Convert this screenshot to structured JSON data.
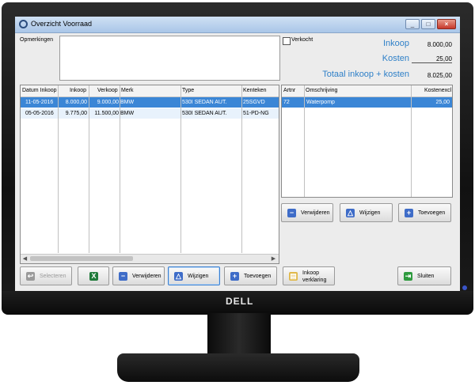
{
  "window": {
    "title": "Overzicht Voorraad",
    "min": "_",
    "max": "□",
    "close": "×"
  },
  "form": {
    "opmerkingen_label": "Opmerkingen",
    "verkocht_label": "Verkocht"
  },
  "summary": {
    "inkoop_label": "Inkoop",
    "inkoop_value": "8.000,00",
    "kosten_label": "Kosten",
    "kosten_value": "25,00",
    "totaal_label": "Totaal inkoop + kosten",
    "totaal_value": "8.025,00"
  },
  "stock_table": {
    "headers": [
      "Datum Inkoop",
      "Inkoop",
      "Verkoop",
      "Merk",
      "Type",
      "Kenteken"
    ],
    "rows": [
      [
        "11-05-2016",
        "8.000,00",
        "9.000,00",
        "BMW",
        "530I SEDAN AUT.",
        "25SGVD"
      ],
      [
        "05-05-2016",
        "9.775,00",
        "11.500,00",
        "BMW",
        "530I SEDAN AUT.",
        "51-PD-NG"
      ]
    ]
  },
  "cost_table": {
    "headers": [
      "Artnr",
      "Omschrijving",
      "Kostenexcl"
    ],
    "rows": [
      [
        "72",
        "Waterpomp",
        "25,00"
      ]
    ]
  },
  "cost_buttons": {
    "verwijderen": "Verwijderen",
    "wijzigen": "Wijzigen",
    "toevoegen": "Toevoegen"
  },
  "bottom_buttons": {
    "selecteren": "Selecteren",
    "verwijderen": "Verwijderen",
    "wijzigen": "Wijzigen",
    "toevoegen": "Toevoegen",
    "inkoopverklaring_1": "Inkoop",
    "inkoopverklaring_2": "verklaring",
    "sluiten": "Sluiten"
  },
  "brand": "DELL",
  "colors": {
    "accent": "#2f80c8",
    "selection": "#3b86d6",
    "excel_green": "#1f7a3a"
  }
}
